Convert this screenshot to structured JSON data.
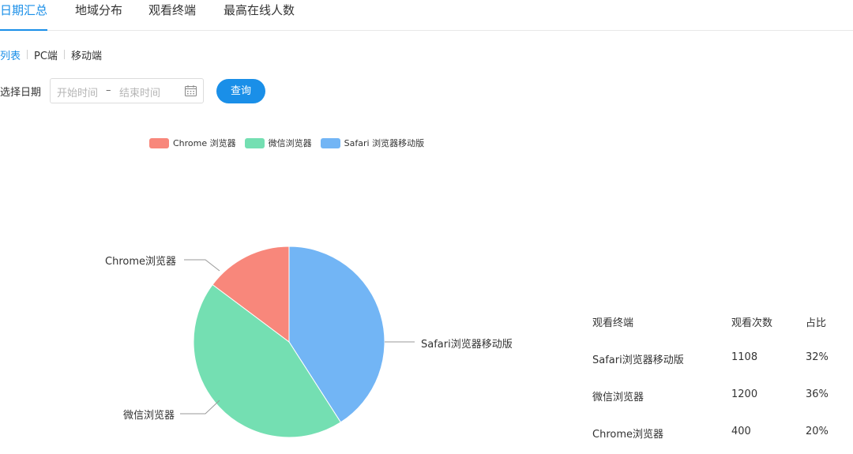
{
  "tabs": [
    {
      "label": "日期汇总",
      "active": true
    },
    {
      "label": "地域分布",
      "active": false
    },
    {
      "label": "观看终端",
      "active": false
    },
    {
      "label": "最高在线人数",
      "active": false
    }
  ],
  "subnav": {
    "items": [
      {
        "label": "列表",
        "active": true
      },
      {
        "label": "PC端",
        "active": false
      },
      {
        "label": "移动端",
        "active": false
      }
    ]
  },
  "filter": {
    "date_label": "选择日期",
    "start_placeholder": "开始时间",
    "separator": "–",
    "end_placeholder": "结束时间",
    "query_label": "查询",
    "calendar_icon": "calendar-icon"
  },
  "colors": {
    "accent": "#1a8fe8",
    "chrome": "#f8877b",
    "wechat": "#74dfb2",
    "safari": "#72b5f5"
  },
  "chart_data": {
    "type": "pie",
    "legend_position": "top",
    "legend": [
      "Chrome 浏览器",
      "微信浏览器",
      "Safari 浏览器移动版"
    ],
    "slices": [
      {
        "label": "Safari浏览器移动版",
        "value": 1108,
        "color": "#72b5f5"
      },
      {
        "label": "微信浏览器",
        "value": 1200,
        "color": "#74dfb2"
      },
      {
        "label": "Chrome浏览器",
        "value": 400,
        "color": "#f8877b"
      }
    ]
  },
  "table": {
    "headers": [
      "观看终端",
      "观看次数",
      "占比"
    ],
    "rows": [
      {
        "terminal": "Safari浏览器移动版",
        "count": "1108",
        "ratio": "32%"
      },
      {
        "terminal": "微信浏览器",
        "count": "1200",
        "ratio": "36%"
      },
      {
        "terminal": "Chrome浏览器",
        "count": "400",
        "ratio": "20%"
      }
    ]
  }
}
